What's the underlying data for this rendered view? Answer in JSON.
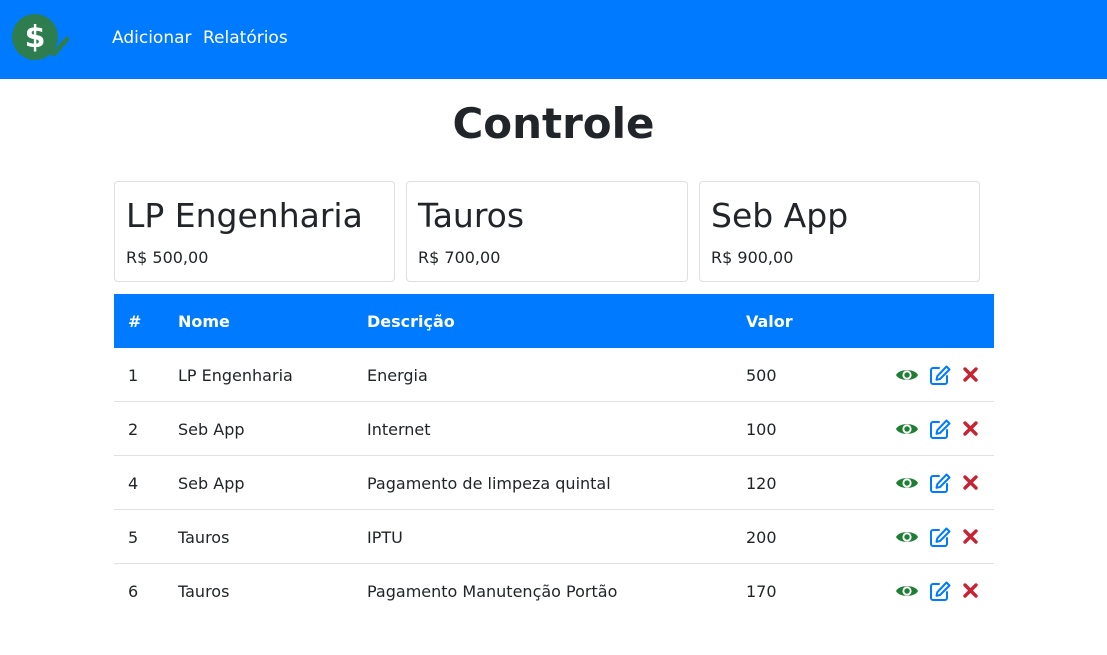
{
  "nav": {
    "links": [
      {
        "label": "Adicionar"
      },
      {
        "label": "Relatórios"
      }
    ]
  },
  "page": {
    "title": "Controle"
  },
  "cards": [
    {
      "title": "LP Engenharia",
      "value": "R$ 500,00"
    },
    {
      "title": "Tauros",
      "value": "R$ 700,00"
    },
    {
      "title": "Seb App",
      "value": "R$ 900,00"
    }
  ],
  "table": {
    "headers": {
      "id": "#",
      "nome": "Nome",
      "descricao": "Descrição",
      "valor": "Valor"
    },
    "rows": [
      {
        "id": "1",
        "nome": "LP Engenharia",
        "descricao": "Energia",
        "valor": "500"
      },
      {
        "id": "2",
        "nome": "Seb App",
        "descricao": "Internet",
        "valor": "100"
      },
      {
        "id": "4",
        "nome": "Seb App",
        "descricao": "Pagamento de limpeza quintal",
        "valor": "120"
      },
      {
        "id": "5",
        "nome": "Tauros",
        "descricao": "IPTU",
        "valor": "200"
      },
      {
        "id": "6",
        "nome": "Tauros",
        "descricao": "Pagamento Manutenção Portão",
        "valor": "170"
      }
    ],
    "row_actions": [
      "eye-icon",
      "edit-icon",
      "delete-icon"
    ]
  },
  "colors": {
    "primary": "#007bff",
    "logo_green": "#2e7d4f",
    "view_green": "#1e7e34",
    "edit_blue": "#007bff",
    "delete_red": "#c82333"
  },
  "icons": {
    "logo": "dollar-check-logo",
    "view": "eye-icon",
    "edit": "edit-icon",
    "delete": "close-icon"
  }
}
